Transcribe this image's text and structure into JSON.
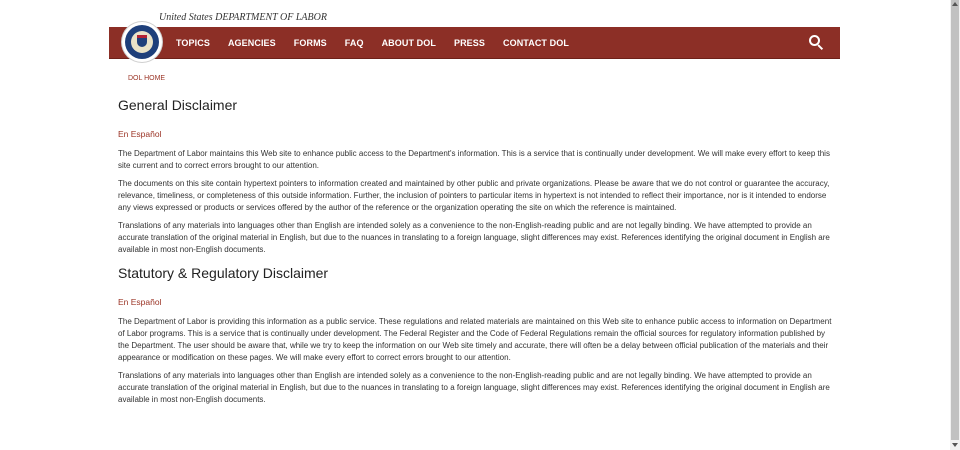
{
  "header": {
    "agency_line": "United States DEPARTMENT OF LABOR",
    "seal_icon": "dol-seal-icon",
    "search_icon": "search-icon"
  },
  "nav": {
    "items": [
      "TOPICS",
      "AGENCIES",
      "FORMS",
      "FAQ",
      "ABOUT DOL",
      "PRESS",
      "CONTACT DOL"
    ]
  },
  "breadcrumb": {
    "home": "DOL HOME"
  },
  "sections": [
    {
      "title": "General Disclaimer",
      "lang_link": "En Español",
      "paragraphs": [
        "The Department of Labor maintains this Web site to enhance public access to the Department's information. This is a service that is continually under development. We will make every effort to keep this site current and to correct errors brought to our attention.",
        "The documents on this site contain hypertext pointers to information created and maintained by other public and private organizations. Please be aware that we do not control or guarantee the accuracy, relevance, timeliness, or completeness of this outside information. Further, the inclusion of pointers to particular items in hypertext is not intended to reflect their importance, nor is it intended to endorse any views expressed or products or services offered by the author of the reference or the organization operating the site on which the reference is maintained.",
        "Translations of any materials into languages other than English are intended solely as a convenience to the non-English-reading public and are not legally binding. We have attempted to provide an accurate translation of the original material in English, but due to the nuances in translating to a foreign language, slight differences may exist. References identifying the original document in English are available in most non-English documents."
      ]
    },
    {
      "title": "Statutory & Regulatory Disclaimer",
      "lang_link": "En Español",
      "paragraphs": [
        "The Department of Labor is providing this information as a public service. These regulations and related materials are maintained on this Web site to enhance public access to information on Department of Labor programs. This is a service that is continually under development. The Federal Register and the Code of Federal Regulations remain the official sources for regulatory information published by the Department. The user should be aware that, while we try to keep the information on our Web site timely and accurate, there will often be a delay between official publication of the materials and their appearance or modification on these pages. We will make every effort to correct errors brought to our attention.",
        "Translations of any materials into languages other than English are intended solely as a convenience to the non-English-reading public and are not legally binding. We have attempted to provide an accurate translation of the original material in English, but due to the nuances in translating to a foreign language, slight differences may exist. References identifying the original document in English are available in most non-English documents."
      ]
    }
  ],
  "colors": {
    "nav_bg": "#8c2f26",
    "link": "#9b3426",
    "seal_blue": "#1e3f7a"
  }
}
